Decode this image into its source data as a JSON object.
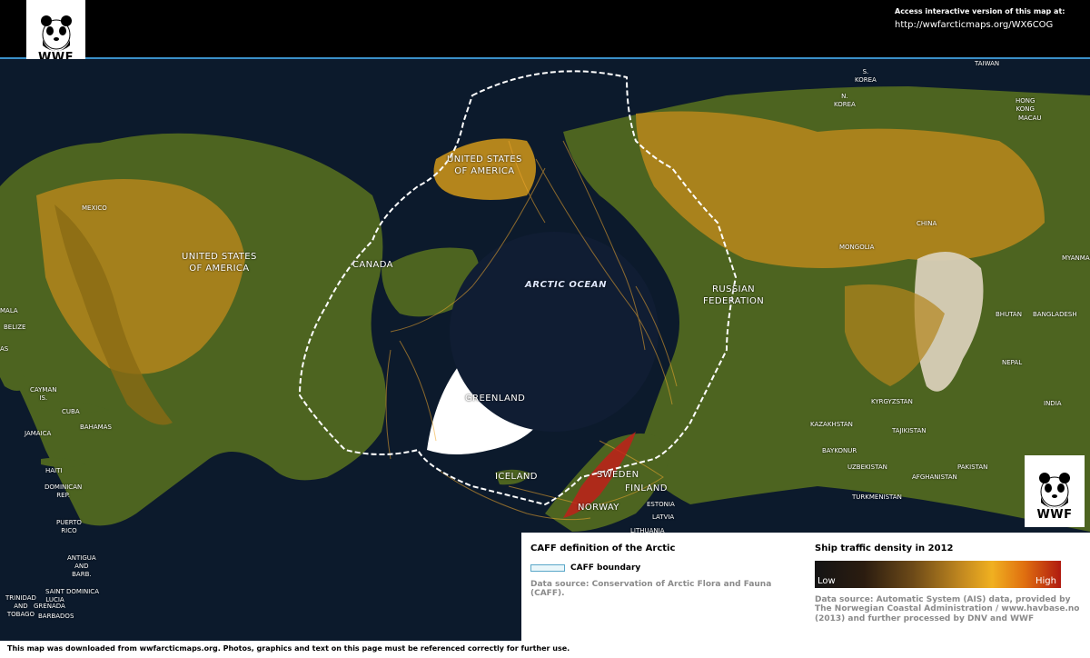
{
  "header": {
    "logo_text": "WWF",
    "access_label": "Access interactive version of this map at:",
    "access_url": "http://wwfarcticmaps.org/WX6COG"
  },
  "map": {
    "ocean_label": "ARCTIC OCEAN",
    "labels": [
      {
        "id": "usa-main",
        "text": "UNITED STATES\nOF AMERICA",
        "size": "big"
      },
      {
        "id": "usa-alaska",
        "text": "UNITED STATES\nOF AMERICA",
        "size": "big"
      },
      {
        "id": "canada",
        "text": "CANADA",
        "size": "big"
      },
      {
        "id": "russia",
        "text": "RUSSIAN\nFEDERATION",
        "size": "big"
      },
      {
        "id": "greenland",
        "text": "GREENLAND",
        "size": "big"
      },
      {
        "id": "iceland",
        "text": "ICELAND",
        "size": "big"
      },
      {
        "id": "sweden",
        "text": "SWEDEN",
        "size": "big"
      },
      {
        "id": "finland",
        "text": "FINLAND",
        "size": "big"
      },
      {
        "id": "norway",
        "text": "NORWAY",
        "size": "big"
      },
      {
        "id": "mexico",
        "text": "MEXICO"
      },
      {
        "id": "belize",
        "text": "BELIZE"
      },
      {
        "id": "guatemala",
        "text": "MALA"
      },
      {
        "id": "cayman",
        "text": "CAYMAN\nIS."
      },
      {
        "id": "cuba",
        "text": "CUBA"
      },
      {
        "id": "bahamas",
        "text": "BAHAMAS"
      },
      {
        "id": "jamaica",
        "text": "JAMAICA"
      },
      {
        "id": "haiti",
        "text": "HAITI"
      },
      {
        "id": "dominican",
        "text": "DOMINICAN\nREP."
      },
      {
        "id": "puerto-rico",
        "text": "PUERTO\nRICO"
      },
      {
        "id": "antigua",
        "text": "ANTIGUA\nAND\nBARB."
      },
      {
        "id": "saint-lucia",
        "text": "SAINT\nLUCIA"
      },
      {
        "id": "dominica",
        "text": "DOMINICA"
      },
      {
        "id": "trinidad",
        "text": "TRINIDAD\nAND\nTOBAGO"
      },
      {
        "id": "grenada",
        "text": "GRENADA"
      },
      {
        "id": "barbados",
        "text": "BARBADOS"
      },
      {
        "id": "as",
        "text": "AS"
      },
      {
        "id": "taiwan",
        "text": "TAIWAN"
      },
      {
        "id": "s-korea",
        "text": "S.\nKOREA"
      },
      {
        "id": "n-korea",
        "text": "N.\nKOREA"
      },
      {
        "id": "hong-kong",
        "text": "HONG\nKONG"
      },
      {
        "id": "macau",
        "text": "MACAU"
      },
      {
        "id": "china",
        "text": "CHINA"
      },
      {
        "id": "mongolia",
        "text": "MONGOLIA"
      },
      {
        "id": "myanmar",
        "text": "MYANMAR"
      },
      {
        "id": "bhutan",
        "text": "BHUTAN"
      },
      {
        "id": "bangladesh",
        "text": "BANGLADESH"
      },
      {
        "id": "nepal",
        "text": "NEPAL"
      },
      {
        "id": "india",
        "text": "INDIA"
      },
      {
        "id": "kyrgyzstan",
        "text": "KYRGYZSTAN"
      },
      {
        "id": "tajikistan",
        "text": "TAJIKISTAN"
      },
      {
        "id": "kazakhstan",
        "text": "KAZAKHSTAN"
      },
      {
        "id": "baykonur",
        "text": "BAYKONUR"
      },
      {
        "id": "uzbekistan",
        "text": "UZBEKISTAN"
      },
      {
        "id": "afghanistan",
        "text": "AFGHANISTAN"
      },
      {
        "id": "pakistan",
        "text": "PAKISTAN"
      },
      {
        "id": "turkmenistan",
        "text": "TURKMENISTAN"
      },
      {
        "id": "estonia",
        "text": "ESTONIA"
      },
      {
        "id": "latvia",
        "text": "LATVIA"
      },
      {
        "id": "lithuania",
        "text": "LITHUANIA"
      }
    ]
  },
  "legend": {
    "caff": {
      "title": "CAFF definition of the Arctic",
      "boundary_label": "CAFF boundary",
      "source": "Data source: Conservation of Arctic Flora and Fauna (CAFF)."
    },
    "ship": {
      "title": "Ship traffic density in 2012",
      "low_label": "Low",
      "high_label": "High",
      "source": "Data source: Automatic System (AIS) data, provided by The Norwegian Coastal Administration / www.havbase.no (2013) and further processed by DNV and WWF"
    }
  },
  "footer": {
    "text": "This map was downloaded from wwfarcticmaps.org. Photos, graphics and text on this page must be referenced correctly for further use."
  },
  "colors": {
    "ocean": "#0c1a2c",
    "land_green": "#4d6420",
    "land_ochre": "#b4851c",
    "ship_traffic": "#f2a92e",
    "boundary": "#ffffff",
    "header_rule": "#3a8fc8"
  }
}
